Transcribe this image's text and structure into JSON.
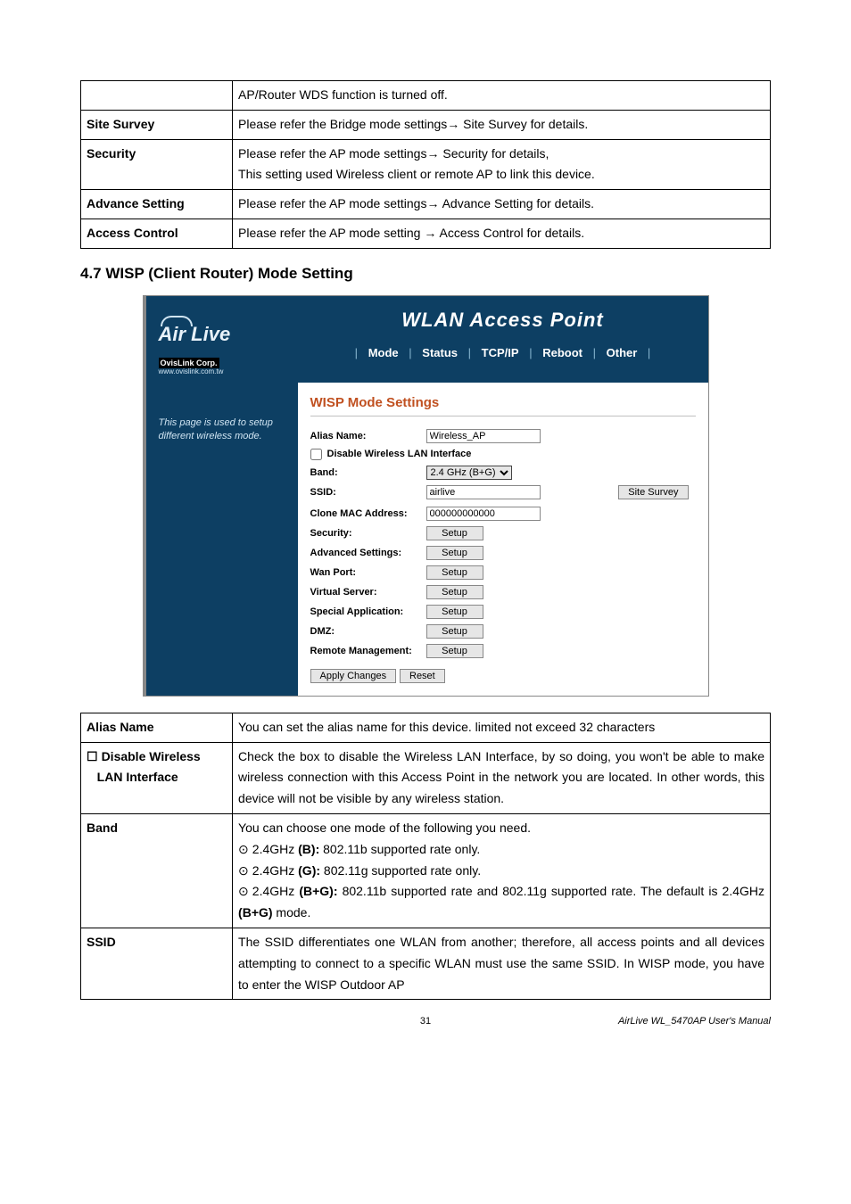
{
  "topTable": {
    "rows": [
      {
        "label": "",
        "desc": "AP/Router WDS function is turned off."
      },
      {
        "label": "Site Survey",
        "desc": "Please refer the Bridge mode settings→ Site Survey for details."
      },
      {
        "label": "Security",
        "desc": "Please refer the AP mode settings→ Security for details,\nThis setting used Wireless client or remote AP to link this device."
      },
      {
        "label": "Advance Setting",
        "desc": "Please refer the AP mode settings→ Advance Setting for details."
      },
      {
        "label": "Access Control",
        "desc": "Please refer the AP mode setting → Access Control for details."
      }
    ]
  },
  "sectionHeading": "4.7 WISP (Client Router) Mode Setting",
  "screenshot": {
    "brand": "Air Live",
    "brandSub": "OvisLink Corp.",
    "brandUrl": "www.ovislink.com.tw",
    "title": "WLAN Access Point",
    "menu": [
      "Mode",
      "Status",
      "TCP/IP",
      "Reboot",
      "Other"
    ],
    "sideNote": "This page is used to setup different wireless mode.",
    "panelTitle": "WISP Mode Settings",
    "fields": {
      "aliasLabel": "Alias Name:",
      "aliasValue": "Wireless_AP",
      "disableLabel": "Disable Wireless LAN Interface",
      "bandLabel": "Band:",
      "bandValue": "2.4 GHz (B+G)",
      "ssidLabel": "SSID:",
      "ssidValue": "airlive",
      "siteSurveyBtn": "Site Survey",
      "cloneMacLabel": "Clone MAC Address:",
      "cloneMacValue": "000000000000",
      "securityLabel": "Security:",
      "advSettingsLabel": "Advanced Settings:",
      "wanPortLabel": "Wan Port:",
      "virtualServerLabel": "Virtual Server:",
      "specialAppLabel": "Special Application:",
      "dmzLabel": "DMZ:",
      "remoteMgmtLabel": "Remote Management:",
      "setupBtn": "Setup",
      "applyBtn": "Apply Changes",
      "resetBtn": "Reset"
    }
  },
  "bottomTable": {
    "rows": [
      {
        "label": "Alias Name",
        "desc": "You can set the alias name for this device. limited not exceed 32 characters"
      },
      {
        "label": "☐ Disable Wireless\n   LAN Interface",
        "desc": "Check the box to disable the Wireless LAN Interface, by so doing, you won't be able to make wireless connection with this Access Point in the network you are located. In other words, this device will not be visible by any wireless station."
      },
      {
        "label": "Band",
        "desc": "You can choose one mode of the following you need.\n⊙ 2.4GHz (B): 802.11b supported rate only.\n⊙ 2.4GHz (G): 802.11g supported rate only.\n⊙ 2.4GHz (B+G): 802.11b supported rate and 802.11g supported rate. The default is 2.4GHz (B+G) mode."
      },
      {
        "label": "SSID",
        "desc": "The SSID differentiates one WLAN from another; therefore, all access points and all devices attempting to connect to a specific WLAN must use the same SSID. In WISP mode, you have to enter the WISP Outdoor AP"
      }
    ]
  },
  "footer": {
    "pageNum": "31",
    "manual": "AirLive WL_5470AP User's Manual"
  }
}
